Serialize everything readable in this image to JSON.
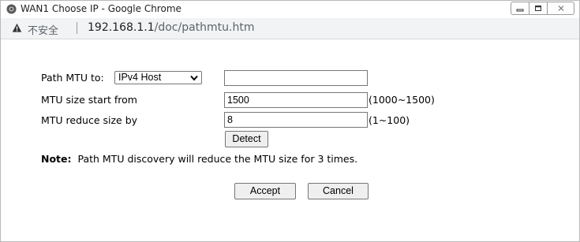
{
  "window": {
    "title": "WAN1 Choose IP - Google Chrome"
  },
  "addressbar": {
    "security_label": "不安全",
    "url_host": "192.168.1.1",
    "url_path": "/doc/pathmtu.htm"
  },
  "form": {
    "path_mtu_label": "Path MTU to:",
    "path_mtu_select": "IPv4 Host",
    "path_mtu_value": "",
    "start_label": "MTU size start from",
    "start_value": "1500",
    "start_range": "(1000~1500)",
    "reduce_label": "MTU reduce size by",
    "reduce_value": "8",
    "reduce_range": "(1~100)",
    "detect_label": "Detect",
    "note_bold": "Note:",
    "note_text": "Path MTU discovery will reduce the MTU size for 3 times.",
    "accept_label": "Accept",
    "cancel_label": "Cancel"
  },
  "colors": {
    "window_border": "#b9b9b9",
    "addressbar_bg": "#f1f3f4",
    "button_bg": "#efefef"
  }
}
